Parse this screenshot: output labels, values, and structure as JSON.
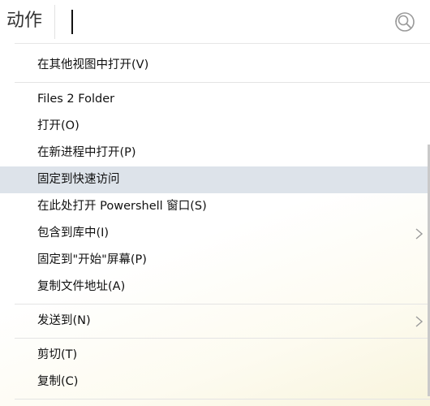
{
  "search": {
    "label": "动作",
    "query": ""
  },
  "menu": {
    "items": [
      {
        "label": "在其他视图中打开(V)"
      },
      {
        "label": "Files 2 Folder"
      },
      {
        "label": "打开(O)"
      },
      {
        "label": "在新进程中打开(P)"
      },
      {
        "label": "固定到快速访问"
      },
      {
        "label": "在此处打开 Powershell 窗口(S)"
      },
      {
        "label": "包含到库中(I)"
      },
      {
        "label": "固定到\"开始\"屏幕(P)"
      },
      {
        "label": "复制文件地址(A)"
      },
      {
        "label": "发送到(N)"
      },
      {
        "label": "剪切(T)"
      },
      {
        "label": "复制(C)"
      }
    ]
  },
  "colors": {
    "highlight": "#dde3ea",
    "separator": "#e4e4e4",
    "icon": "#9a9a9a"
  }
}
